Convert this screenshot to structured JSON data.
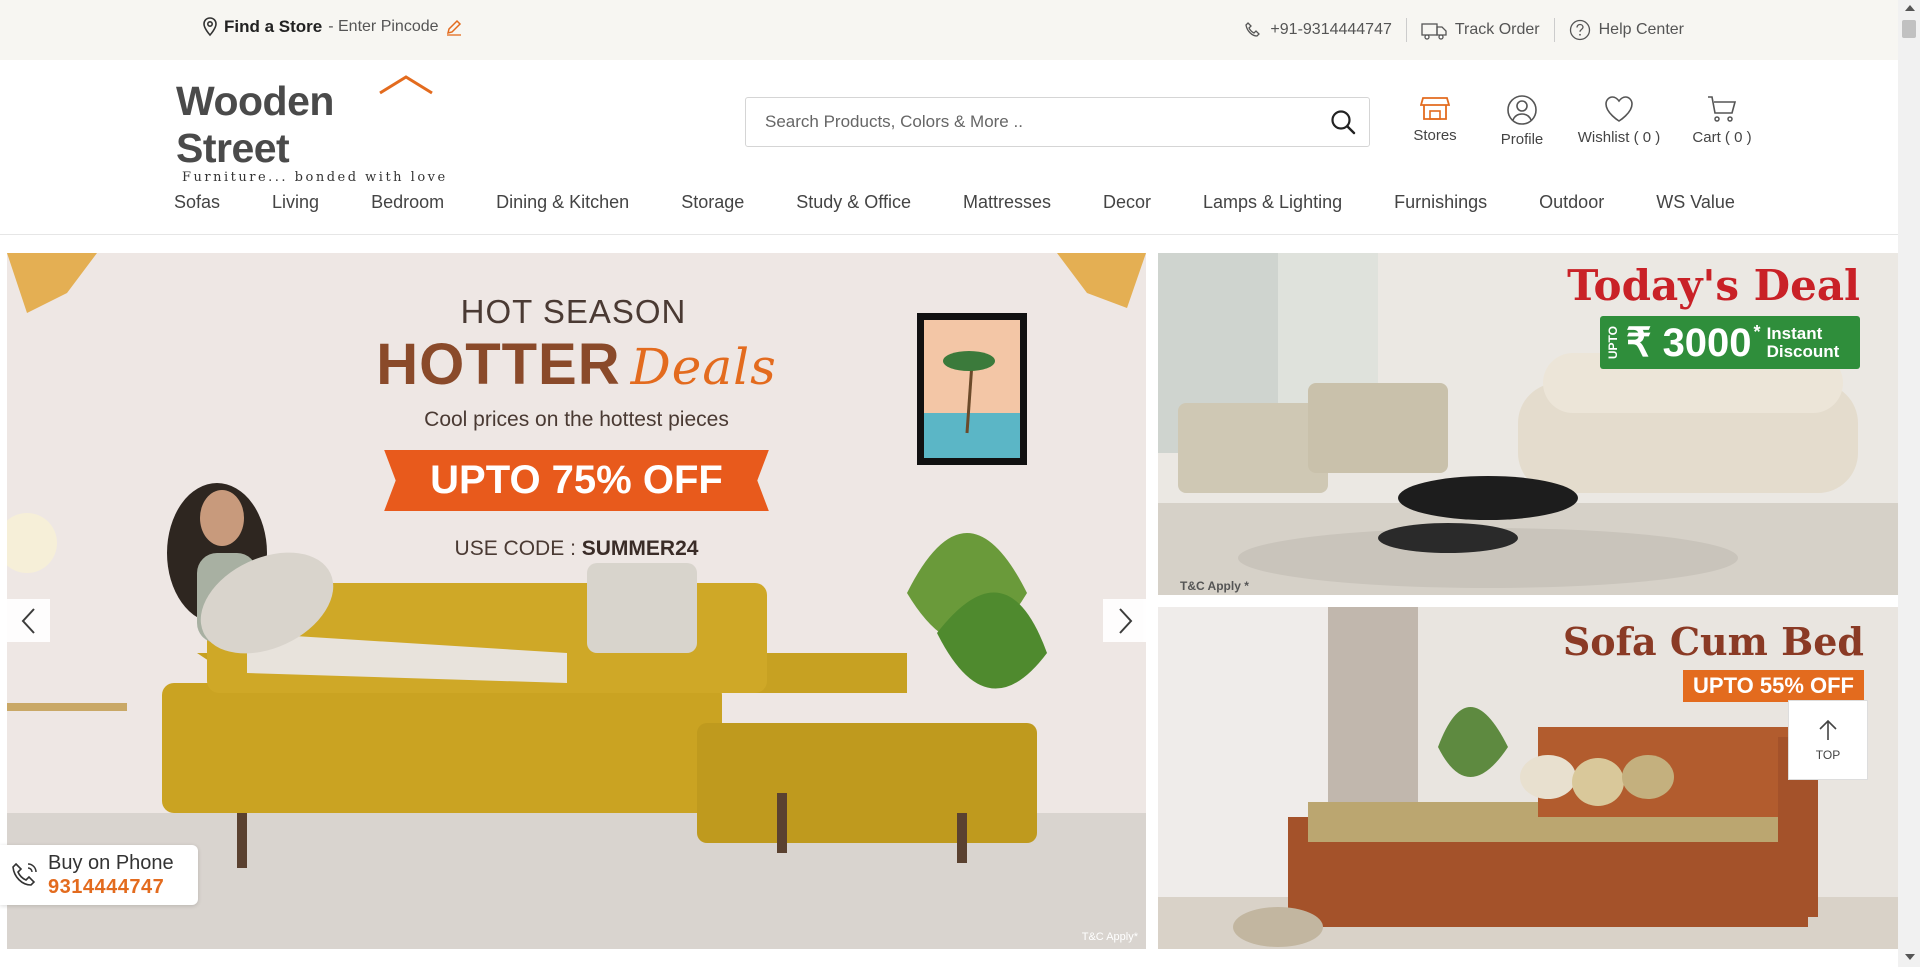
{
  "topbar": {
    "find_store": "Find a Store",
    "pincode": " - Enter Pincode",
    "phone": "+91-9314444747",
    "track_order": "Track Order",
    "help_center": "Help Center"
  },
  "header": {
    "logo_main": "Wooden Street",
    "logo_tagline": "Furniture... bonded with love",
    "search_placeholder": "Search Products, Colors & More ..",
    "icons": [
      {
        "label": "Stores",
        "icon": "store-icon"
      },
      {
        "label": "Profile",
        "icon": "profile-icon"
      },
      {
        "label": "Wishlist ( 0 )",
        "icon": "heart-icon"
      },
      {
        "label": "Cart ( 0 )",
        "icon": "cart-icon"
      }
    ]
  },
  "nav": {
    "items": [
      "Sofas",
      "Living",
      "Bedroom",
      "Dining & Kitchen",
      "Storage",
      "Study & Office",
      "Mattresses",
      "Decor",
      "Lamps & Lighting",
      "Furnishings",
      "Outdoor",
      "WS Value"
    ]
  },
  "hero": {
    "line1": "HOT SEASON",
    "line2": "HOTTER",
    "line2_script": "Deals",
    "line3": "Cool prices on the hottest pieces",
    "offer": "UPTO 75% OFF",
    "code_label": "USE CODE : ",
    "code": "SUMMER24",
    "tc": "T&C Apply*"
  },
  "buy_on_phone": {
    "label": "Buy on Phone",
    "number": "9314444747"
  },
  "deal_banner": {
    "title": "Today's Deal",
    "upto": "UPTO",
    "amount": "₹ 3000",
    "asterisk": "*",
    "desc_line1": "Instant",
    "desc_line2": "Discount",
    "tc": "T&C Apply *"
  },
  "sofabed_banner": {
    "title": "Sofa Cum Bed",
    "offer": "UPTO 55% OFF"
  },
  "top_button": {
    "label": "TOP"
  },
  "colors": {
    "accent": "#e36b1e",
    "deal_red": "#c92127",
    "deal_green": "#2f8e3b"
  }
}
